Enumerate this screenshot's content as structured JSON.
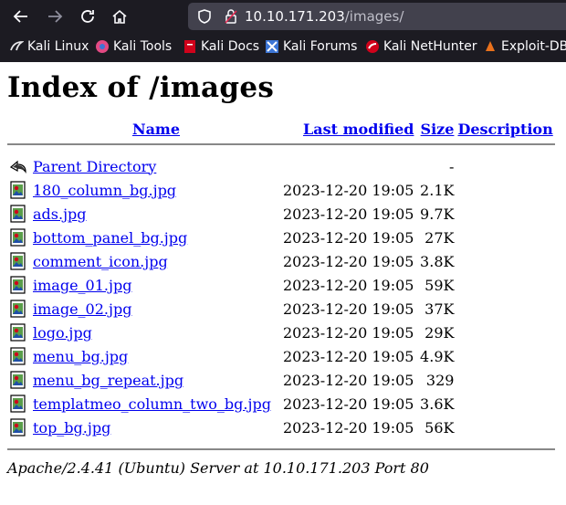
{
  "browser": {
    "url_host": "10.10.171.203",
    "url_path": "/images/",
    "icons": [
      "back-icon",
      "forward-icon",
      "reload-icon",
      "home-icon",
      "shield-icon",
      "lock-icon"
    ]
  },
  "bookmarks": [
    {
      "label": "Kali Linux",
      "icon": "kali-icon",
      "color": "#e7e7ea"
    },
    {
      "label": "Kali Tools",
      "icon": "kali-tools-icon",
      "color": "#e24a84"
    },
    {
      "label": "Kali Docs",
      "icon": "kali-docs-icon",
      "color": "#d0021b"
    },
    {
      "label": "Kali Forums",
      "icon": "kali-forums-icon",
      "color": "#3d76d6"
    },
    {
      "label": "Kali NetHunter",
      "icon": "nethunter-icon",
      "color": "#d0021b"
    },
    {
      "label": "Exploit-DB",
      "icon": "exploitdb-icon",
      "color": "#e9711c"
    }
  ],
  "page": {
    "title": "Index of /images",
    "columns": {
      "name": "Name",
      "modified": "Last modified",
      "size": "Size",
      "description": "Description"
    },
    "parent": {
      "label": "Parent Directory",
      "size": "-"
    },
    "files": [
      {
        "name": "180_column_bg.jpg",
        "modified": "2023-12-20 19:05",
        "size": "2.1K"
      },
      {
        "name": "ads.jpg",
        "modified": "2023-12-20 19:05",
        "size": "9.7K"
      },
      {
        "name": "bottom_panel_bg.jpg",
        "modified": "2023-12-20 19:05",
        "size": "27K"
      },
      {
        "name": "comment_icon.jpg",
        "modified": "2023-12-20 19:05",
        "size": "3.8K"
      },
      {
        "name": "image_01.jpg",
        "modified": "2023-12-20 19:05",
        "size": "59K"
      },
      {
        "name": "image_02.jpg",
        "modified": "2023-12-20 19:05",
        "size": "37K"
      },
      {
        "name": "logo.jpg",
        "modified": "2023-12-20 19:05",
        "size": "29K"
      },
      {
        "name": "menu_bg.jpg",
        "modified": "2023-12-20 19:05",
        "size": "4.9K"
      },
      {
        "name": "menu_bg_repeat.jpg",
        "modified": "2023-12-20 19:05",
        "size": "329"
      },
      {
        "name": "templatmeo_column_two_bg.jpg",
        "modified": "2023-12-20 19:05",
        "size": "3.6K"
      },
      {
        "name": "top_bg.jpg",
        "modified": "2023-12-20 19:05",
        "size": "56K"
      }
    ],
    "footer": "Apache/2.4.41 (Ubuntu) Server at 10.10.171.203 Port 80"
  }
}
